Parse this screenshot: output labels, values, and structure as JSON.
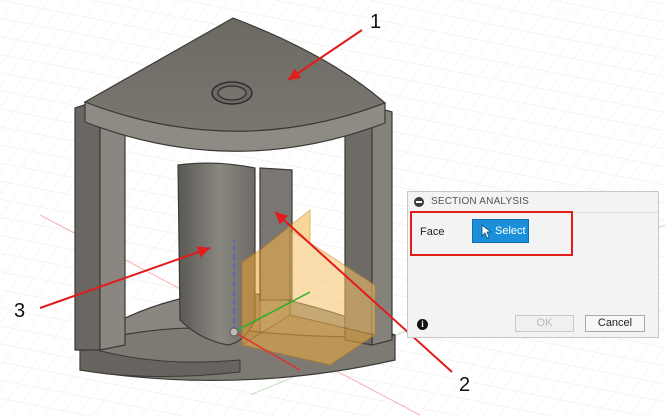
{
  "callouts": {
    "one": "1",
    "two": "2",
    "three": "3"
  },
  "panel": {
    "title": "SECTION ANALYSIS",
    "face_label": "Face",
    "select_label": "Select",
    "ok_label": "OK",
    "cancel_label": "Cancel",
    "info_glyph": "i"
  },
  "icons": {
    "collapse": "minus-circle-icon",
    "cursor": "arrow-cursor-icon",
    "info": "info-icon"
  },
  "colors": {
    "accent": "#1b8fd9",
    "highlight": "#e21b1b",
    "model": "#6e6b66",
    "section_plane": "#f0a530"
  }
}
